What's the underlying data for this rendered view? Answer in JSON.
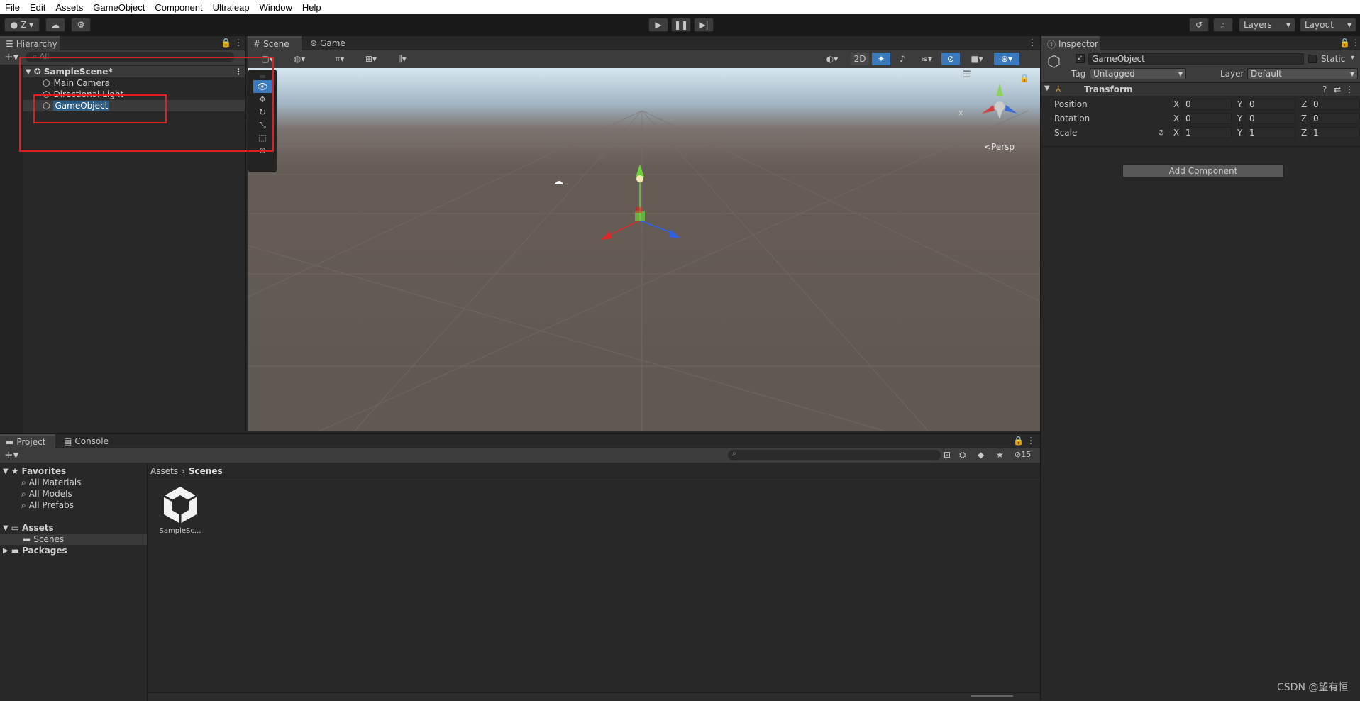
{
  "menu": [
    "File",
    "Edit",
    "Assets",
    "GameObject",
    "Component",
    "Ultraleap",
    "Window",
    "Help"
  ],
  "toolbar": {
    "account_label": "Z",
    "layers_label": "Layers",
    "layout_label": "Layout"
  },
  "hierarchy": {
    "tab_label": "Hierarchy",
    "search_placeholder": "All",
    "scene_name": "SampleScene*",
    "items": [
      "Main Camera",
      "Directional Light",
      "GameObject"
    ]
  },
  "scene_view": {
    "tabs": [
      "Scene",
      "Game"
    ],
    "toggle_2d": "2D",
    "projection_label": "<Persp"
  },
  "inspector": {
    "tab_label": "Inspector",
    "object_name": "GameObject",
    "static_label": "Static",
    "tag_label": "Tag",
    "tag_value": "Untagged",
    "layer_label": "Layer",
    "layer_value": "Default",
    "transform_title": "Transform",
    "rows": [
      {
        "label": "Position",
        "x": "0",
        "y": "0",
        "z": "0"
      },
      {
        "label": "Rotation",
        "x": "0",
        "y": "0",
        "z": "0"
      },
      {
        "label": "Scale",
        "x": "1",
        "y": "1",
        "z": "1"
      }
    ],
    "axis_x": "X",
    "axis_y": "Y",
    "axis_z": "Z",
    "add_component": "Add Component"
  },
  "project": {
    "tabs": [
      "Project",
      "Console"
    ],
    "favorites_label": "Favorites",
    "favorites": [
      "All Materials",
      "All Models",
      "All Prefabs"
    ],
    "assets_label": "Assets",
    "scenes_label": "Scenes",
    "packages_label": "Packages",
    "breadcrumb": [
      "Assets",
      "Scenes"
    ],
    "hidden_count": "15",
    "asset_name": "SampleSc..."
  },
  "watermark": "CSDN @望有恒",
  "colors": {
    "selection": "#2c5d87",
    "highlight_red": "#e02020",
    "accent_blue": "#3a79bb"
  }
}
